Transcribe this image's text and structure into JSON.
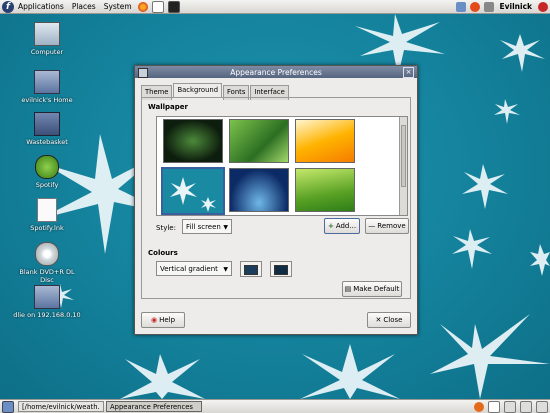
{
  "top_panel": {
    "menus": [
      "Applications",
      "Places",
      "System"
    ],
    "user": "Evilnick"
  },
  "desktop_icons": [
    {
      "label": "Computer"
    },
    {
      "label": "evilnick's Home"
    },
    {
      "label": "Wastebasket"
    },
    {
      "label": "Spotify"
    },
    {
      "label": "Spotify.lnk"
    },
    {
      "label": "Blank DVD+R DL Disc"
    },
    {
      "label": "dlie on 192.168.0.10"
    }
  ],
  "window": {
    "title": "Appearance Preferences",
    "tabs": [
      "Theme",
      "Background",
      "Fonts",
      "Interface"
    ],
    "active_tab": "Background",
    "wallpaper_label": "Wallpaper",
    "style_label": "Style:",
    "style_value": "Fill screen",
    "add_label": "Add...",
    "remove_label": "Remove",
    "colours_label": "Colours",
    "colours_value": "Vertical gradient",
    "make_default_label": "Make Default",
    "help_label": "Help",
    "close_label": "Close",
    "colour1": "#1d3d5c",
    "colour2": "#0f2c44"
  },
  "taskbar": {
    "items": [
      "[/home/evilnick/weath...",
      "Appearance Preferences"
    ]
  }
}
